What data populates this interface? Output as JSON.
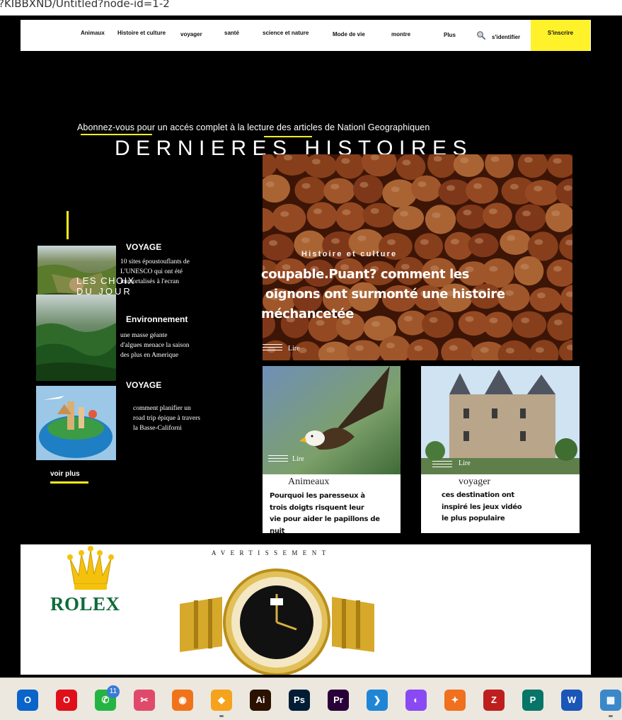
{
  "browser": {
    "url_fragment": "?KIBBXND/Untitled?node-id=1-2"
  },
  "nav": {
    "items": [
      "Animaux",
      "Histoire et culture",
      "voyager",
      "santé",
      "science et nature",
      "Mode de vie",
      "montre",
      "Plus"
    ],
    "signin": "s'identifier",
    "subscribe": "S'inscrire",
    "search_icon": "magnifier-icon",
    "accent_color": "#fff22a"
  },
  "promo": "Abonnez-vous pour un accés complet à la lecture des articles de Nationl Geographiquen",
  "headline": "DERNIERES HISTOIRES",
  "hero": {
    "category": "Histoire et culture",
    "title_lines": [
      "coupable.Puant? comment les",
      " oignons ont surmonté une histoire",
      "méchancetée"
    ],
    "read": "Lire"
  },
  "picks": {
    "heading_line1": "LES CHOIX",
    "heading_line2": "DU JOUR",
    "items": [
      {
        "category": "VOYAGE",
        "lines": [
          "10 sites époustouflants  de",
          "L'UNESCO qui ont été",
          "immortalisés à l'ecran"
        ]
      },
      {
        "category": "Environnement",
        "lines": [
          "une masse géante",
          "d'algues menace la saison",
          "des  plus  en Amerique"
        ]
      },
      {
        "category": "VOYAGE",
        "lines": [
          "comment planifier un",
          "road trip épique à travers",
          "la Basse-Californi"
        ]
      }
    ],
    "more": "voir plus"
  },
  "cards": [
    {
      "category": "Animeaux",
      "read": "Lire",
      "lines": [
        "Pourquoi les paresseux à",
        "trois doigts risquent leur",
        "vie pour aider le papillons de nuit"
      ]
    },
    {
      "category": "voyager",
      "read": "Lire",
      "lines": [
        "ces destination ont",
        "inspiré  les jeux vidéo",
        "le plus populaire"
      ]
    }
  ],
  "ad": {
    "label": "AVERTISSEMENT",
    "brand": "ROLEX"
  },
  "taskbar": {
    "apps": [
      {
        "name": "outlook-icon",
        "glyph": "O",
        "color": "#0a64c9"
      },
      {
        "name": "opera-icon",
        "glyph": "O",
        "color": "#e0101b"
      },
      {
        "name": "whatsapp-icon",
        "glyph": "✆",
        "color": "#25b444",
        "badge": "11"
      },
      {
        "name": "snipping-tool-icon",
        "glyph": "✂",
        "color": "#e04a6a"
      },
      {
        "name": "firefox-icon",
        "glyph": "◉",
        "color": "#f0731b"
      },
      {
        "name": "avast-browser-icon",
        "glyph": "◆",
        "color": "#f5a21c"
      },
      {
        "name": "illustrator-icon",
        "glyph": "Ai",
        "color": "#2a1100"
      },
      {
        "name": "photoshop-icon",
        "glyph": "Ps",
        "color": "#001d35"
      },
      {
        "name": "premiere-icon",
        "glyph": "Pr",
        "color": "#2a0039"
      },
      {
        "name": "vscode-icon",
        "glyph": "❯",
        "color": "#1f86d6"
      },
      {
        "name": "figma-like-icon",
        "glyph": "◐",
        "color": "#8a4af3"
      },
      {
        "name": "star-app-icon",
        "glyph": "✦",
        "color": "#f0701e"
      },
      {
        "name": "filezilla-icon",
        "glyph": "Z",
        "color": "#bf1e1e"
      },
      {
        "name": "publisher-icon",
        "glyph": "P",
        "color": "#077568"
      },
      {
        "name": "word-icon",
        "glyph": "W",
        "color": "#1a56b8"
      },
      {
        "name": "control-panel-icon",
        "glyph": "▦",
        "color": "#3a88c8"
      }
    ]
  }
}
